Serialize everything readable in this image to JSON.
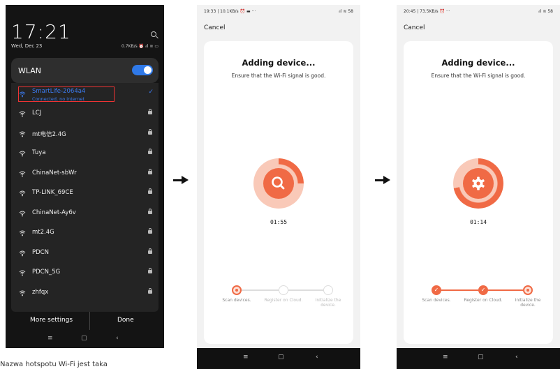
{
  "phone1": {
    "time": "17:21",
    "date": "Wed, Dec 23",
    "status": "0.7KB/s ⏰ ᵢıl ≋ ▭",
    "wlan_label": "WLAN",
    "wlan_enabled": true,
    "active_network": {
      "name": "SmartLife-2064a4",
      "status": "Connected, no internet"
    },
    "networks": [
      {
        "name": "LCJ"
      },
      {
        "name": "mt电信2.4G"
      },
      {
        "name": "Tuya"
      },
      {
        "name": "ChinaNet-sbWr"
      },
      {
        "name": "TP-LINK_69CE"
      },
      {
        "name": "ChinaNet-Ay6v"
      },
      {
        "name": "mt2.4G"
      },
      {
        "name": "PDCN"
      },
      {
        "name": "PDCN_5G"
      },
      {
        "name": "zhfqx"
      }
    ],
    "more_settings": "More settings",
    "done": "Done",
    "nav": [
      "≡",
      "▢",
      "‹"
    ]
  },
  "caption": "Nazwa hotspotu Wi-Fi jest taka",
  "phone2": {
    "status_left": "19:33 | 10.1KB/s ⏰ ▬ ···",
    "status_right": "ᵢıl ≋ 58",
    "cancel": "Cancel",
    "title": "Adding device...",
    "subtitle": "Ensure that the Wi-Fi signal is good.",
    "icon": "search-icon",
    "progress": 0.25,
    "timer": "01:55",
    "steps": [
      {
        "label": "Scan devices.",
        "state": "active"
      },
      {
        "label": "Register on Cloud.",
        "state": "pending"
      },
      {
        "label": "Initialize the device.",
        "state": "pending"
      }
    ],
    "nav": [
      "≡",
      "▢",
      "‹"
    ]
  },
  "phone3": {
    "status_left": "20:45 | 73.5KB/s ⏰ ···",
    "status_right": "ᵢıl ≋ 58",
    "cancel": "Cancel",
    "title": "Adding device...",
    "subtitle": "Ensure that the Wi-Fi signal is good.",
    "icon": "gear-icon",
    "progress": 0.72,
    "timer": "01:14",
    "steps": [
      {
        "label": "Scan devices.",
        "state": "done"
      },
      {
        "label": "Register on Cloud.",
        "state": "done"
      },
      {
        "label": "Initialize the device.",
        "state": "active"
      }
    ],
    "nav": [
      "≡",
      "▢",
      "‹"
    ]
  },
  "colors": {
    "accent_blue": "#2f79e8",
    "brand_orange": "#f06a45",
    "ring_light": "#f9c9b8",
    "highlight_red": "#e33333"
  }
}
